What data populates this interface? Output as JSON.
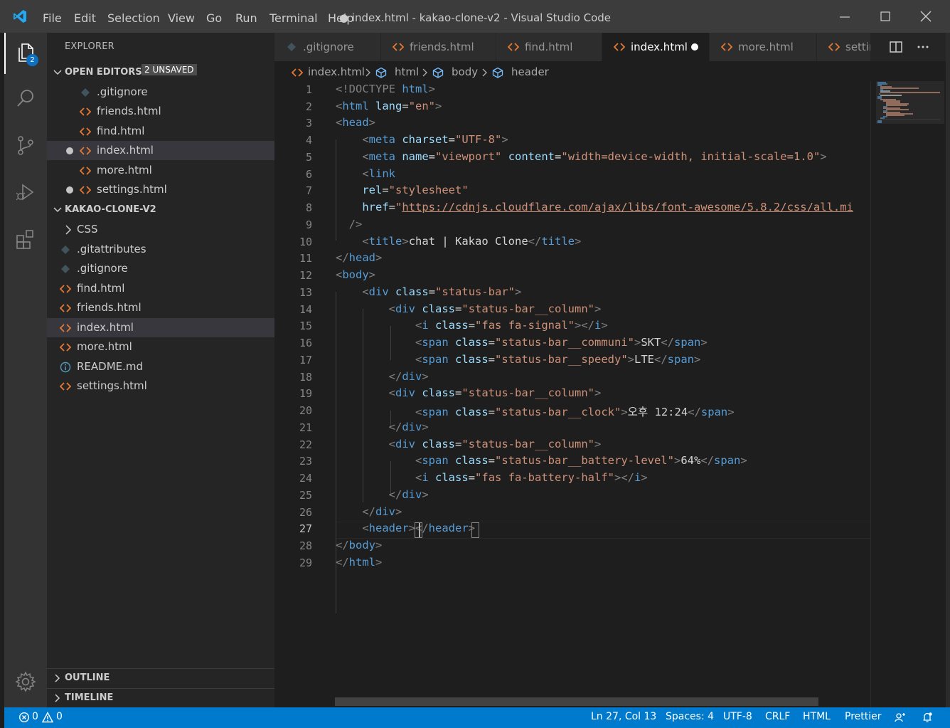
{
  "window": {
    "title": "● index.html - kakao-clone-v2 - Visual Studio Code",
    "menu": [
      "File",
      "Edit",
      "Selection",
      "View",
      "Go",
      "Run",
      "Terminal",
      "Help"
    ]
  },
  "activity": {
    "explorer_badge": "2"
  },
  "sidebar": {
    "title": "EXPLORER",
    "open_editors": {
      "title": "OPEN EDITORS",
      "badge": "2 UNSAVED",
      "items": [
        {
          "label": ".gitignore",
          "icon": "git-icon",
          "modified": false
        },
        {
          "label": "friends.html",
          "icon": "html-icon",
          "modified": false
        },
        {
          "label": "find.html",
          "icon": "html-icon",
          "modified": false
        },
        {
          "label": "index.html",
          "icon": "html-icon",
          "modified": true
        },
        {
          "label": "more.html",
          "icon": "html-icon",
          "modified": false
        },
        {
          "label": "settings.html",
          "icon": "html-icon",
          "modified": true
        }
      ]
    },
    "project": {
      "title": "KAKAO-CLONE-V2",
      "items": [
        {
          "label": "CSS",
          "icon": "folder-chevron"
        },
        {
          "label": ".gitattributes",
          "icon": "git-icon"
        },
        {
          "label": ".gitignore",
          "icon": "git-icon"
        },
        {
          "label": "find.html",
          "icon": "html-icon"
        },
        {
          "label": "friends.html",
          "icon": "html-icon"
        },
        {
          "label": "index.html",
          "icon": "html-icon"
        },
        {
          "label": "more.html",
          "icon": "html-icon"
        },
        {
          "label": "README.md",
          "icon": "info-icon"
        },
        {
          "label": "settings.html",
          "icon": "html-icon"
        }
      ]
    },
    "outline": "OUTLINE",
    "timeline": "TIMELINE"
  },
  "tabs": [
    {
      "label": ".gitignore",
      "icon": "git-icon"
    },
    {
      "label": "friends.html",
      "icon": "html-icon"
    },
    {
      "label": "find.html",
      "icon": "html-icon"
    },
    {
      "label": "index.html",
      "icon": "html-icon",
      "active": true,
      "modified": true
    },
    {
      "label": "more.html",
      "icon": "html-icon"
    },
    {
      "label": "setting",
      "icon": "html-icon"
    }
  ],
  "breadcrumb": [
    "index.html",
    "html",
    "body",
    "header"
  ],
  "editor": {
    "line_numbers": [
      "1",
      "2",
      "3",
      "4",
      "5",
      "6",
      "7",
      "8",
      "9",
      "10",
      "11",
      "12",
      "13",
      "14",
      "15",
      "16",
      "17",
      "18",
      "19",
      "20",
      "21",
      "22",
      "23",
      "24",
      "25",
      "26",
      "27",
      "28",
      "29"
    ],
    "strings": {
      "doctype": "<!DOCTYPE",
      "html": "html",
      "lang": "lang",
      "en": "\"en\"",
      "head": "head",
      "meta": "meta",
      "charset": "charset",
      "utf8": "\"UTF-8\"",
      "name": "name",
      "viewport": "\"viewport\"",
      "content": "content",
      "viewport_val": "\"width=device-width, initial-scale=1.0\"",
      "link": "link",
      "rel": "rel",
      "stylesheet": "\"stylesheet\"",
      "href": "href",
      "href_val": "https://cdnjs.cloudflare.com/ajax/libs/font-awesome/5.8.2/css/all.mi",
      "self_close": "/>",
      "title": "title",
      "title_text": "chat | Kakao Clone",
      "body": "body",
      "div": "div",
      "class": "class",
      "status_bar": "\"status-bar\"",
      "status_bar_column": "\"status-bar__column\"",
      "i": "i",
      "fa_signal": "\"fas fa-signal\"",
      "span": "span",
      "communi": "\"status-bar__communi\"",
      "skt": "SKT",
      "speedy": "\"status-bar__speedy\"",
      "lte": "LTE",
      "clock": "\"status-bar__clock\"",
      "clock_text": "오후 12:24",
      "battery_level": "\"status-bar__battery-level\"",
      "battery_text": "64%",
      "battery_half": "\"fas fa-battery-half\"",
      "header": "header",
      "eq": "="
    }
  },
  "status": {
    "errors": "0",
    "warnings": "0",
    "position": "Ln 27, Col 13",
    "spaces": "Spaces: 4",
    "encoding": "UTF-8",
    "eol": "CRLF",
    "language": "HTML",
    "formatter": "Prettier"
  },
  "colors": {
    "accent": "#007acc",
    "html_icon": "#e37933",
    "git_icon": "#41535b",
    "tag": "#569cd6",
    "attribute": "#9cdcfe",
    "string": "#ce9178"
  }
}
